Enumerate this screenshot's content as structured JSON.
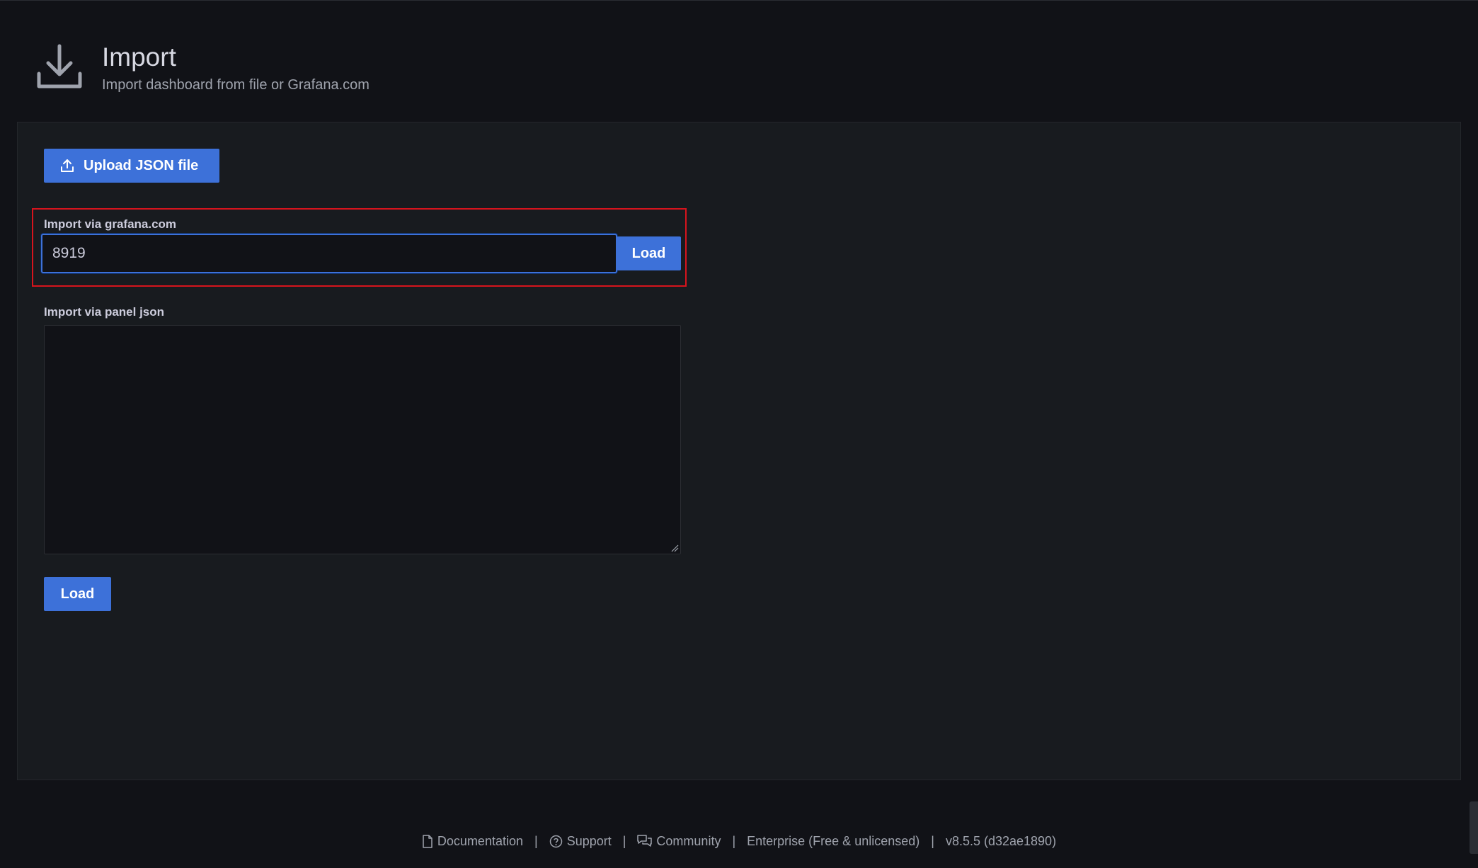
{
  "header": {
    "icon": "download-icon",
    "title": "Import",
    "subtitle": "Import dashboard from file or Grafana.com"
  },
  "upload": {
    "icon": "upload-icon",
    "label": "Upload JSON file"
  },
  "grafana_com": {
    "label": "Import via grafana.com",
    "value": "8919",
    "load_label": "Load"
  },
  "panel_json": {
    "label": "Import via panel json",
    "value": "",
    "load_label": "Load"
  },
  "footer": {
    "documentation": "Documentation",
    "support": "Support",
    "community": "Community",
    "license": "Enterprise (Free & unlicensed)",
    "version": "v8.5.5 (d32ae1890)",
    "separator": "|"
  },
  "colors": {
    "background": "#111217",
    "card": "#181b1f",
    "primary": "#3d71d9",
    "highlight": "#d6141d"
  }
}
